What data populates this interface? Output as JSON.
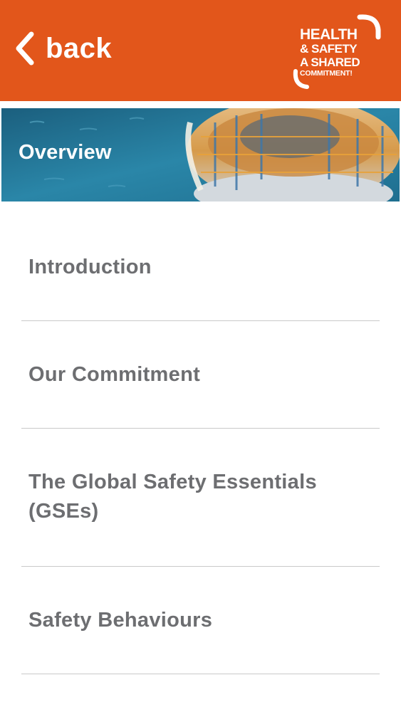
{
  "header": {
    "back_label": "back",
    "logo": {
      "line1": "HEALTH",
      "line2": "& SAFETY",
      "line3": "A SHARED",
      "line4": "COMMITMENT!"
    },
    "background_color": "#e2561b"
  },
  "banner": {
    "title": "Overview"
  },
  "menu": {
    "items": [
      {
        "label": "Introduction"
      },
      {
        "label": "Our Commitment"
      },
      {
        "label": "The Global Safety Essentials (GSEs)"
      },
      {
        "label": "Safety Behaviours"
      }
    ]
  },
  "colors": {
    "accent": "#e2561b",
    "menu_text": "#6d6e71",
    "divider": "#c9c9c9"
  }
}
